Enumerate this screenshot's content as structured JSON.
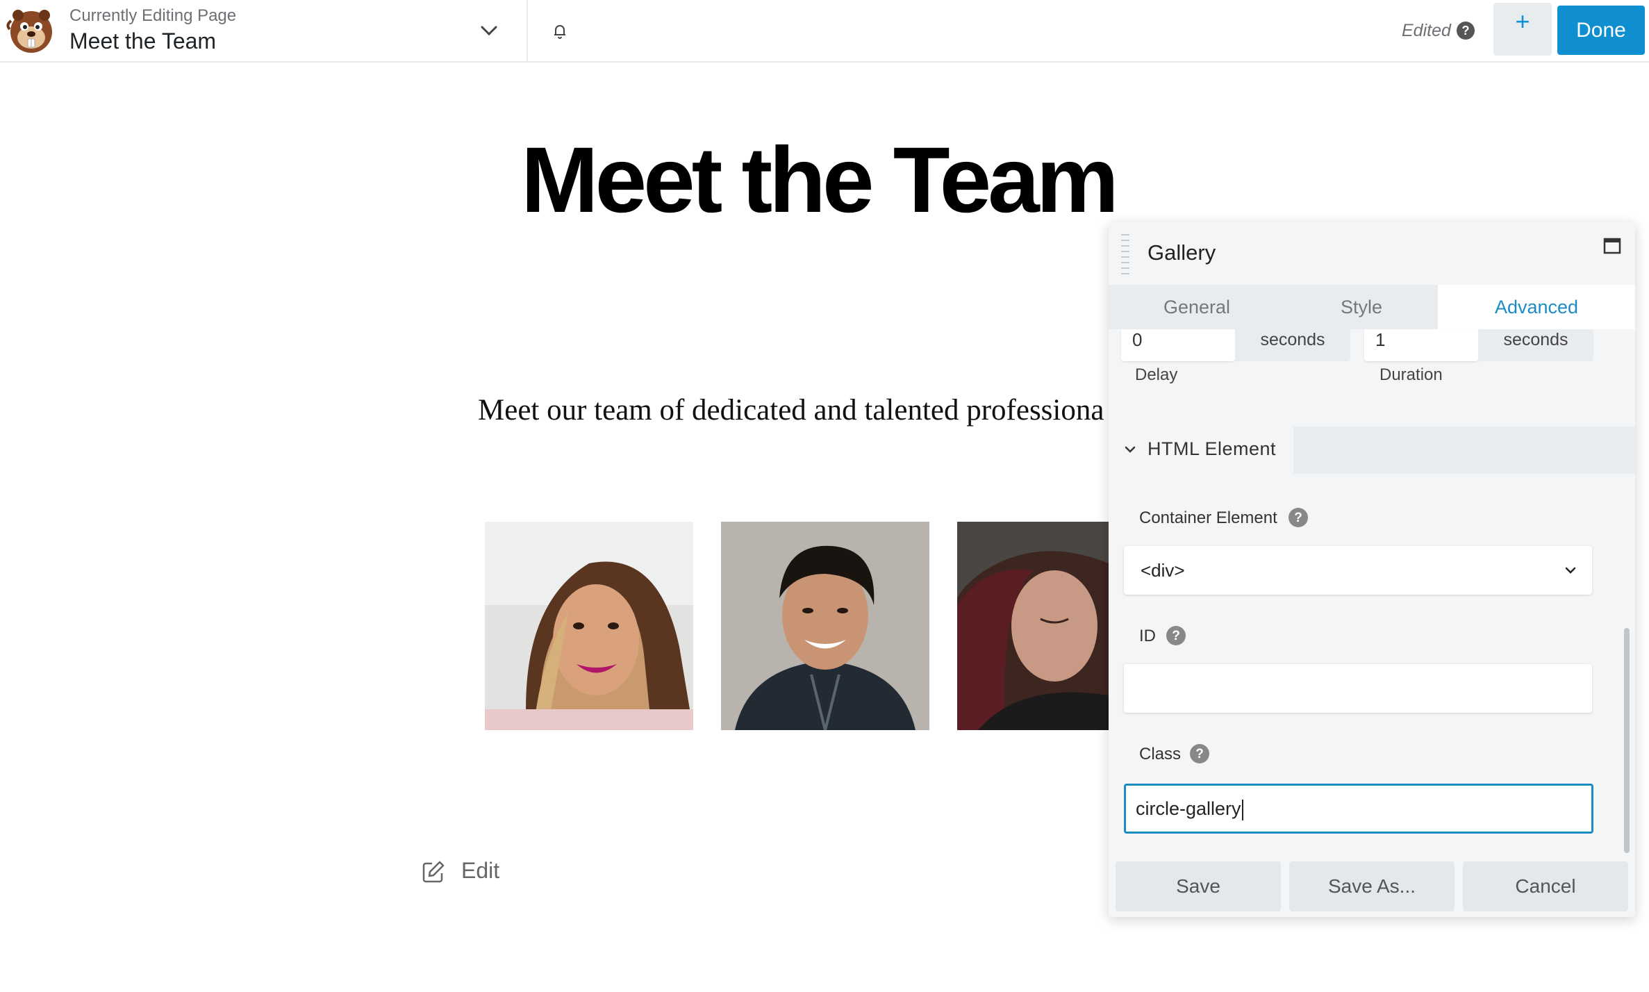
{
  "topbar": {
    "editing_label": "Currently Editing Page",
    "page_name": "Meet the Team",
    "status": "Edited",
    "add_label": "+",
    "done_label": "Done"
  },
  "page": {
    "heading": "Meet the Team",
    "intro": "Meet our team of dedicated and talented professiona",
    "edit_label": "Edit"
  },
  "panel": {
    "title": "Gallery",
    "tabs": [
      "General",
      "Style",
      "Advanced"
    ],
    "active_tab": "Advanced",
    "delay": {
      "value": "0",
      "unit": "seconds",
      "label": "Delay"
    },
    "duration": {
      "value": "1",
      "unit": "seconds",
      "label": "Duration"
    },
    "section_title": "HTML Element",
    "container": {
      "label": "Container Element",
      "value": "<div>"
    },
    "id_field": {
      "label": "ID",
      "value": ""
    },
    "class_field": {
      "label": "Class",
      "value": "circle-gallery"
    },
    "buttons": {
      "save": "Save",
      "save_as": "Save As...",
      "cancel": "Cancel"
    }
  },
  "colors": {
    "accent": "#0f8fcf",
    "tab_active": "#1c8dc4",
    "panel_bg": "#f4f5f6"
  }
}
